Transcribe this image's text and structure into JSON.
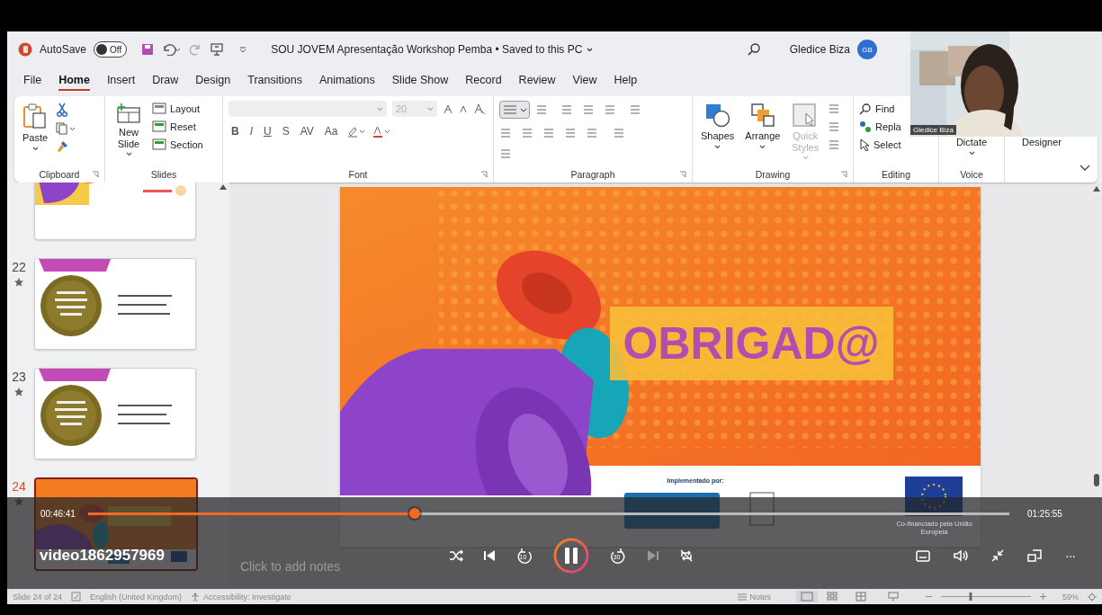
{
  "title_bar": {
    "autosave_label": "AutoSave",
    "autosave_toggle": {
      "label": "Off",
      "on": false
    },
    "document_title": "SOU JOVEM Apresentação Workshop Pemba • Saved to this PC",
    "user_name": "Gledice Biza",
    "avatar_initials": "GB"
  },
  "tabs": [
    {
      "label": "File",
      "selected": false
    },
    {
      "label": "Home",
      "selected": true
    },
    {
      "label": "Insert",
      "selected": false
    },
    {
      "label": "Draw",
      "selected": false
    },
    {
      "label": "Design",
      "selected": false
    },
    {
      "label": "Transitions",
      "selected": false
    },
    {
      "label": "Animations",
      "selected": false
    },
    {
      "label": "Slide Show",
      "selected": false
    },
    {
      "label": "Record",
      "selected": false
    },
    {
      "label": "Review",
      "selected": false
    },
    {
      "label": "View",
      "selected": false
    },
    {
      "label": "Help",
      "selected": false
    }
  ],
  "ribbon": {
    "groups": [
      {
        "label": "Clipboard",
        "buttons": [
          {
            "label": "Paste"
          }
        ]
      },
      {
        "label": "Slides",
        "buttons": [
          {
            "label": "New Slide"
          },
          {
            "label": "Layout"
          },
          {
            "label": "Reset"
          },
          {
            "label": "Section"
          }
        ]
      },
      {
        "label": "Font",
        "font_size": {
          "value": "20",
          "disabled": true
        },
        "format_buttons": [
          "B",
          "I",
          "U",
          "S",
          "AV",
          "Aa"
        ]
      },
      {
        "label": "Paragraph"
      },
      {
        "label": "Drawing",
        "buttons": [
          {
            "label": "Shapes",
            "disabled": false
          },
          {
            "label": "Arrange",
            "disabled": false
          },
          {
            "label": "Quick Styles",
            "disabled": true
          }
        ]
      },
      {
        "label": "Editing",
        "buttons": [
          {
            "label": "Find"
          },
          {
            "label": "Repla"
          },
          {
            "label": "Select"
          }
        ]
      },
      {
        "label": "Voice",
        "buttons": [
          {
            "label": "Dictate"
          }
        ]
      },
      {
        "buttons": [
          {
            "label": "Designer"
          }
        ]
      }
    ]
  },
  "slide_thumbnails": [
    {
      "kind": "megaphone",
      "selected": false
    },
    {
      "kind": "badge",
      "number": "22",
      "selected": false
    },
    {
      "kind": "badge",
      "number": "23",
      "selected": false
    },
    {
      "kind": "closing",
      "number": "24",
      "selected": true
    }
  ],
  "slide": {
    "title": "OBRIGAD@",
    "footer_label": "Implementado por:",
    "eu_caption": "Co-financiado pela União Europeia"
  },
  "notes": {
    "placeholder": "Click to add notes"
  },
  "video_player": {
    "title": "video1862957969",
    "elapsed": "00:46:41",
    "duration": "01:25:55",
    "progress": {
      "level": 0.355
    },
    "playing": true,
    "skip_back": "10",
    "skip_forward": "30",
    "more": "···"
  },
  "status_bar": {
    "slide_counter": "Slide 24 of 24",
    "language": "English (United Kingdom)",
    "accessibility": "Accessibility: Investigate",
    "notes_button": "Notes",
    "zoom": {
      "level": 0.33
    },
    "zoom_percent": "59%"
  },
  "webcam": {
    "name_label": "Gledice Biza"
  }
}
